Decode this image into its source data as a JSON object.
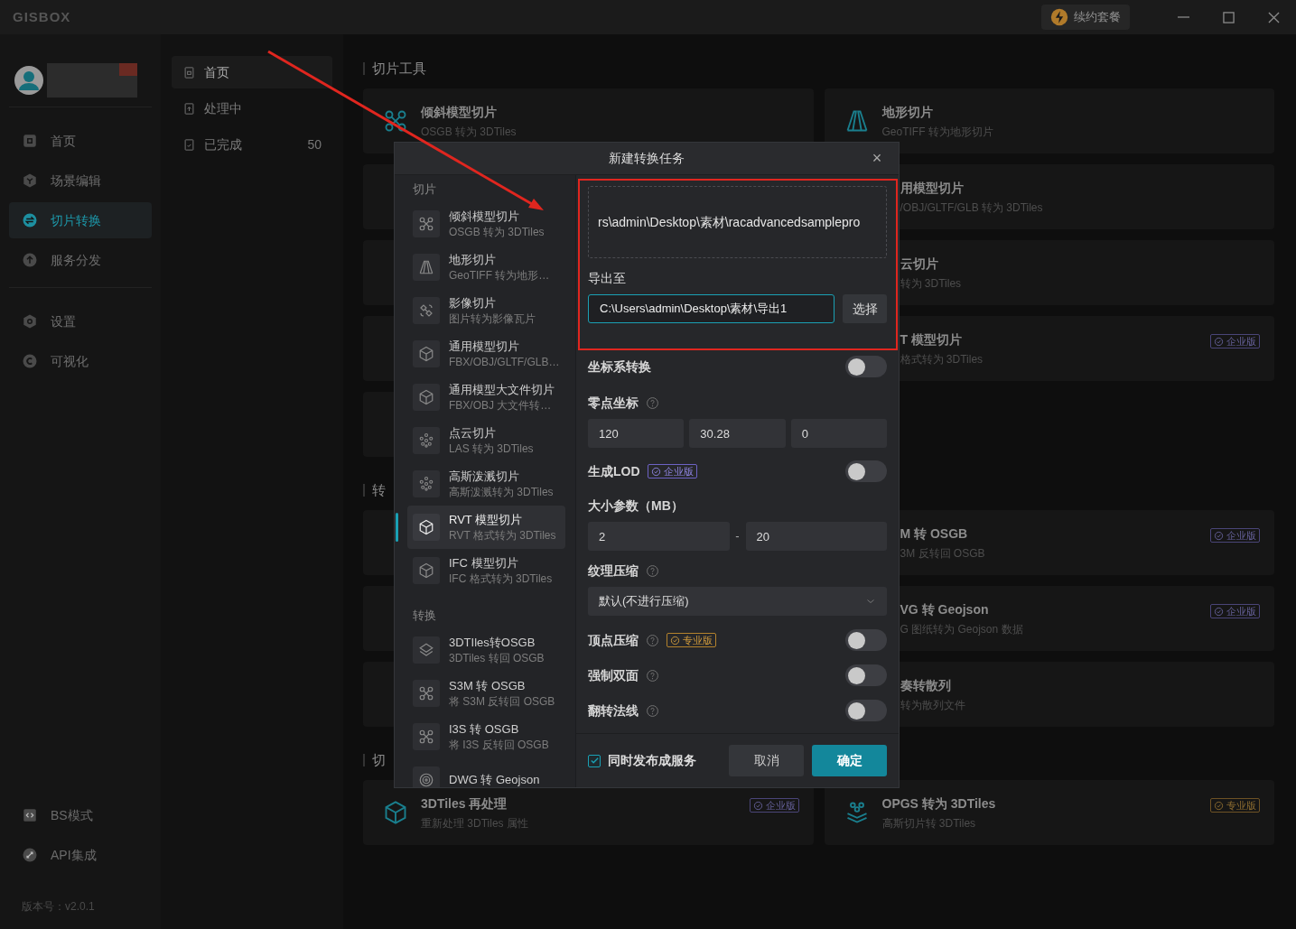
{
  "app": {
    "logo": "GISBOX",
    "renew_button": "续约套餐"
  },
  "sidebar": {
    "groups": [
      [
        {
          "label": "首页",
          "selected": false
        },
        {
          "label": "场景编辑",
          "selected": false
        },
        {
          "label": "切片转换",
          "selected": true
        },
        {
          "label": "服务分发",
          "selected": false
        }
      ],
      [
        {
          "label": "设置",
          "selected": false
        },
        {
          "label": "可视化",
          "selected": false
        }
      ]
    ],
    "bottom_items": [
      {
        "label": "BS模式"
      },
      {
        "label": "API集成"
      }
    ],
    "version": "版本号：v2.0.1"
  },
  "task_panel": {
    "items": [
      {
        "label": "首页",
        "selected": true
      },
      {
        "label": "处理中",
        "selected": false
      },
      {
        "label": "已完成",
        "count": "50",
        "selected": false
      }
    ]
  },
  "main": {
    "sections": [
      {
        "title": "切片工具",
        "cards": [
          {
            "kind": "tool",
            "title": "倾斜模型切片",
            "subtitle": "OSGB 转为 3DTiles"
          },
          {
            "kind": "tool",
            "title": "地形切片",
            "subtitle": "GeoTIFF 转为地形切片"
          },
          {
            "kind": "covered"
          },
          {
            "kind": "partial",
            "title": "用模型切片",
            "subtitle": "/OBJ/GLTF/GLB 转为 3DTiles"
          },
          {
            "kind": "covered"
          },
          {
            "kind": "partial",
            "title": "云切片",
            "subtitle": "转为 3DTiles"
          },
          {
            "kind": "covered"
          },
          {
            "kind": "partial",
            "title": "T 模型切片",
            "subtitle": "格式转为 3DTiles",
            "badge": {
              "label": "企业版",
              "kind": "enterprise"
            }
          },
          {
            "kind": "covered"
          }
        ]
      },
      {
        "title": "转",
        "cards": [
          {
            "kind": "covered"
          },
          {
            "kind": "partial",
            "title": "M 转 OSGB",
            "subtitle": "3M 反转回 OSGB",
            "badge": {
              "label": "企业版",
              "kind": "enterprise"
            }
          },
          {
            "kind": "covered"
          },
          {
            "kind": "partial",
            "title": "VG 转 Geojson",
            "subtitle": "G 图纸转为 Geojson 数据",
            "badge": {
              "label": "企业版",
              "kind": "enterprise"
            }
          },
          {
            "kind": "covered"
          },
          {
            "kind": "partial",
            "title": "奏转散列",
            "subtitle": "转为散列文件"
          }
        ]
      },
      {
        "title": "切",
        "cards": [
          {
            "kind": "tool",
            "title": "3DTiles 再处理",
            "subtitle": "重新处理 3DTiles 属性",
            "badge": {
              "label": "企业版",
              "kind": "enterprise"
            }
          },
          {
            "kind": "tool",
            "title": "OPGS 转为 3DTiles",
            "subtitle": "高斯切片转 3DTiles",
            "badge": {
              "label": "专业版",
              "kind": "pro"
            }
          }
        ]
      }
    ]
  },
  "dialog": {
    "title": "新建转换任务",
    "close": "×",
    "sections": [
      {
        "title": "切片",
        "items": [
          {
            "title": "倾斜模型切片",
            "subtitle": "OSGB 转为 3DTiles",
            "selected": false
          },
          {
            "title": "地形切片",
            "subtitle": "GeoTIFF 转为地形…",
            "selected": false
          },
          {
            "title": "影像切片",
            "subtitle": "图片转为影像瓦片",
            "selected": false
          },
          {
            "title": "通用模型切片",
            "subtitle": "FBX/OBJ/GLTF/GLB…",
            "selected": false
          },
          {
            "title": "通用模型大文件切片",
            "subtitle": "FBX/OBJ 大文件转…",
            "selected": false
          },
          {
            "title": "点云切片",
            "subtitle": "LAS 转为 3DTiles",
            "selected": false
          },
          {
            "title": "高斯泼溅切片",
            "subtitle": "高斯泼溅转为 3DTiles",
            "selected": false
          },
          {
            "title": "RVT 模型切片",
            "subtitle": "RVT 格式转为 3DTiles",
            "selected": true
          },
          {
            "title": "IFC 模型切片",
            "subtitle": "IFC 格式转为 3DTiles",
            "selected": false
          }
        ]
      },
      {
        "title": "转换",
        "items": [
          {
            "title": "3DTIles转OSGB",
            "subtitle": "3DTiles 转回 OSGB",
            "selected": false
          },
          {
            "title": "S3M 转 OSGB",
            "subtitle": "将 S3M 反转回 OSGB",
            "selected": false
          },
          {
            "title": "I3S 转 OSGB",
            "subtitle": "将 I3S 反转回 OSGB",
            "selected": false
          },
          {
            "title": "DWG 转 Geojson",
            "selected": false
          }
        ]
      }
    ],
    "source_path": "rs\\admin\\Desktop\\素材\\racadvancedsamplepro",
    "export_label": "导出至",
    "export_value": "C:\\Users\\admin\\Desktop\\素材\\导出1",
    "choose_button": "选择",
    "fields": [
      {
        "kind": "toggle",
        "label": "坐标系转换",
        "on": false
      },
      {
        "kind": "inputs",
        "label": "零点坐标",
        "help": true,
        "values": [
          "120",
          "30.28",
          "0"
        ]
      },
      {
        "kind": "toggle",
        "label": "生成LOD",
        "badge": {
          "label": "企业版",
          "kind": "enterprise"
        },
        "on": false
      },
      {
        "kind": "range",
        "label": "大小参数（MB）",
        "values": [
          "2",
          "20"
        ],
        "separator": "-"
      },
      {
        "kind": "select",
        "label": "纹理压缩",
        "help": true,
        "value": "默认(不进行压缩)"
      },
      {
        "kind": "toggle",
        "label": "顶点压缩",
        "help": true,
        "badge": {
          "label": "专业版",
          "kind": "pro"
        },
        "on": false
      },
      {
        "kind": "toggle",
        "label": "强制双面",
        "help": true,
        "on": false
      },
      {
        "kind": "toggle",
        "label": "翻转法线",
        "help": true,
        "on": false
      }
    ],
    "publish_checkbox": {
      "label": "同时发布成服务",
      "checked": true
    },
    "buttons": [
      {
        "label": "取消",
        "kind": "secondary"
      },
      {
        "label": "确定",
        "kind": "primary"
      }
    ]
  }
}
